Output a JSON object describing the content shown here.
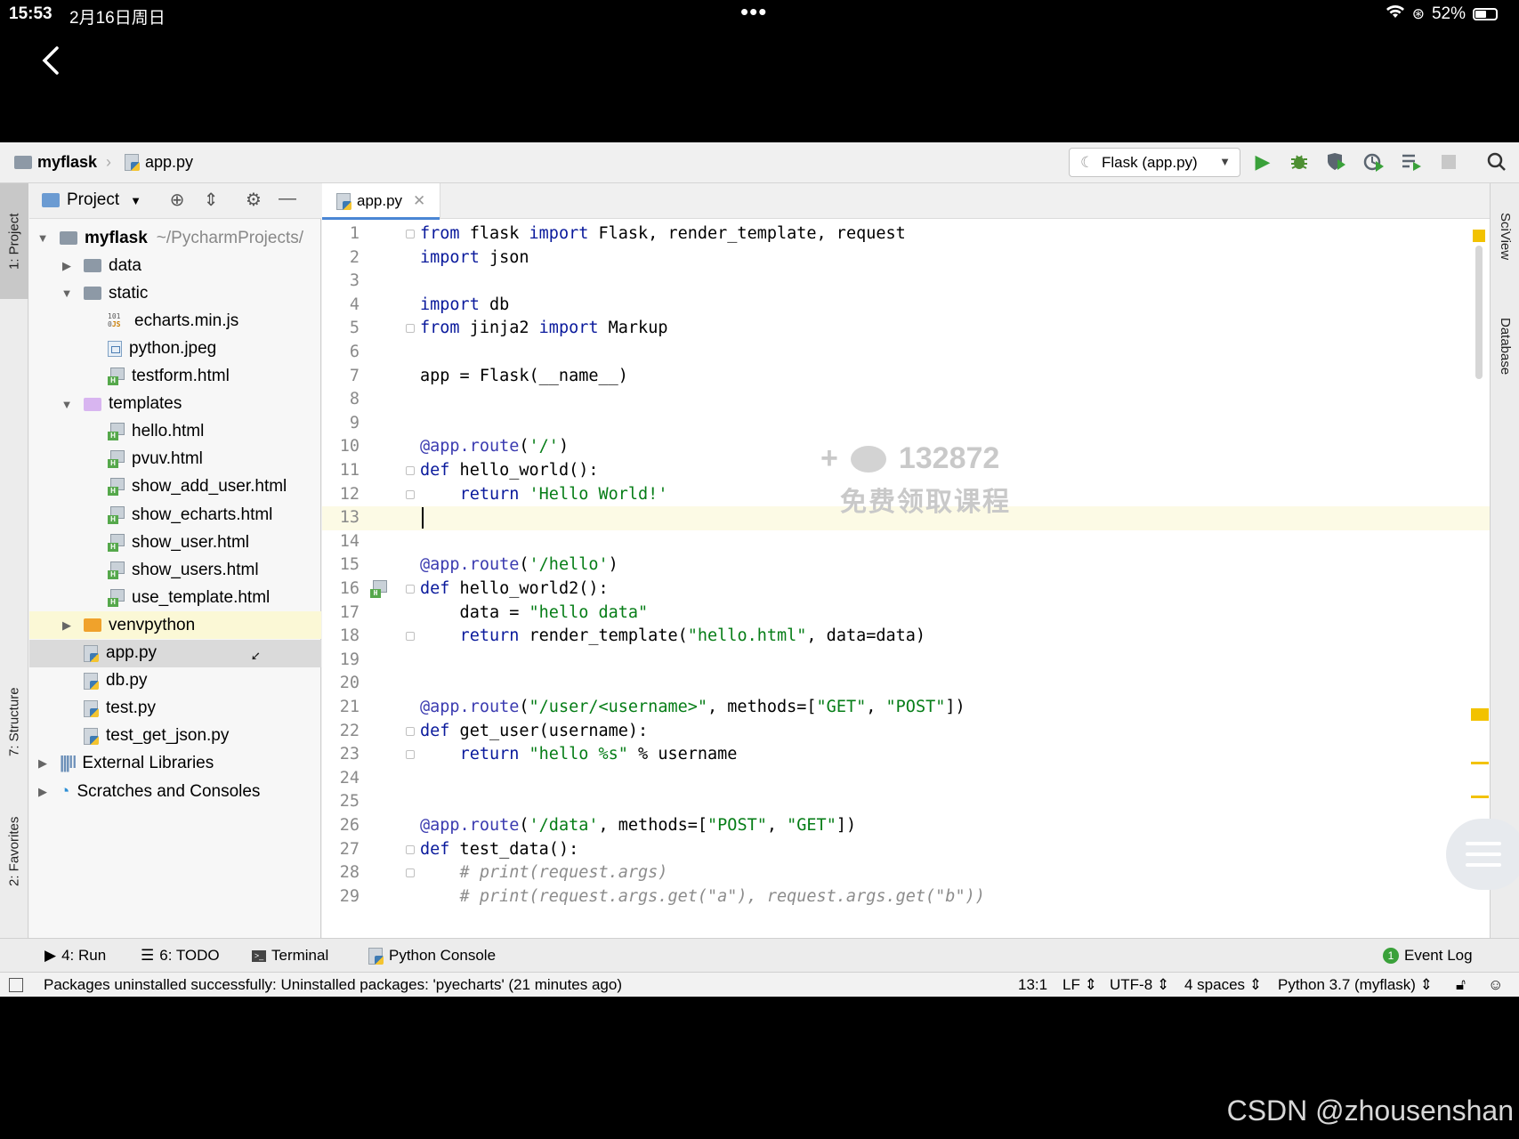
{
  "status_bar": {
    "time": "15:53",
    "date": "2月16日周日",
    "dots": "•••",
    "battery": "52%"
  },
  "nav": {
    "project": "myflask",
    "file": "app.py",
    "run_config": "Flask (app.py)"
  },
  "project_panel": {
    "title": "Project",
    "tree": [
      {
        "label": "myflask",
        "extra": "~/PycharmProjects/",
        "depth": 0,
        "arrow": "▼",
        "icon": "folder"
      },
      {
        "label": "data",
        "depth": 1,
        "arrow": "▶",
        "icon": "folder"
      },
      {
        "label": "static",
        "depth": 1,
        "arrow": "▼",
        "icon": "folder"
      },
      {
        "label": "echarts.min.js",
        "depth": 2,
        "icon": "js"
      },
      {
        "label": "python.jpeg",
        "depth": 2,
        "icon": "image"
      },
      {
        "label": "testform.html",
        "depth": 2,
        "icon": "html"
      },
      {
        "label": "templates",
        "depth": 1,
        "arrow": "▼",
        "icon": "folder-purple"
      },
      {
        "label": "hello.html",
        "depth": 2,
        "icon": "html"
      },
      {
        "label": "pvuv.html",
        "depth": 2,
        "icon": "html"
      },
      {
        "label": "show_add_user.html",
        "depth": 2,
        "icon": "html"
      },
      {
        "label": "show_echarts.html",
        "depth": 2,
        "icon": "html"
      },
      {
        "label": "show_user.html",
        "depth": 2,
        "icon": "html"
      },
      {
        "label": "show_users.html",
        "depth": 2,
        "icon": "html"
      },
      {
        "label": "use_template.html",
        "depth": 2,
        "icon": "html"
      },
      {
        "label": "venvpython",
        "depth": 1,
        "arrow": "▶",
        "icon": "folder-orange"
      },
      {
        "label": "app.py",
        "depth": 1,
        "icon": "python"
      },
      {
        "label": "db.py",
        "depth": 1,
        "icon": "python"
      },
      {
        "label": "test.py",
        "depth": 1,
        "icon": "python"
      },
      {
        "label": "test_get_json.py",
        "depth": 1,
        "icon": "python"
      },
      {
        "label": "External Libraries",
        "depth": 0,
        "arrow": "▶",
        "icon": "libraries"
      },
      {
        "label": "Scratches and Consoles",
        "depth": 0,
        "arrow": "▶",
        "icon": "scratches"
      }
    ]
  },
  "editor": {
    "tab": "app.py",
    "current_line": 13,
    "lines": [
      "from flask import Flask, render_template, request",
      "import json",
      "",
      "import db",
      "from jinja2 import Markup",
      "",
      "app = Flask(__name__)",
      "",
      "",
      "@app.route('/')",
      "def hello_world():",
      "    return 'Hello World!'",
      "",
      "",
      "@app.route('/hello')",
      "def hello_world2():",
      "    data = \"hello data\"",
      "    return render_template(\"hello.html\", data=data)",
      "",
      "",
      "@app.route(\"/user/<username>\", methods=[\"GET\", \"POST\"])",
      "def get_user(username):",
      "    return \"hello %s\" % username",
      "",
      "",
      "@app.route('/data', methods=[\"POST\", \"GET\"])",
      "def test_data():",
      "    # print(request.args)",
      "    # print(request.args.get(\"a\"), request.args.get(\"b\"))"
    ]
  },
  "watermark": {
    "line1": "132872",
    "line2": "免费领取课程"
  },
  "side_tabs": {
    "left": [
      "1: Project",
      "7: Structure",
      "2: Favorites"
    ],
    "right": [
      "SciView",
      "Database"
    ]
  },
  "bottom_tabs": [
    "4: Run",
    "6: TODO",
    "Terminal",
    "Python Console"
  ],
  "event_log": {
    "count": "1",
    "label": "Event Log"
  },
  "status_line": {
    "message": "Packages uninstalled successfully: Uninstalled packages: 'pyecharts' (21 minutes ago)",
    "position": "13:1",
    "line_sep": "LF",
    "encoding": "UTF-8",
    "indent": "4 spaces",
    "interpreter": "Python 3.7 (myflask)"
  },
  "footer_watermark": "CSDN @zhousenshan",
  "colors": {
    "keyword": "#0a1a9c",
    "string": "#067d17",
    "param": "#871094",
    "run_green": "#3aa13a"
  }
}
